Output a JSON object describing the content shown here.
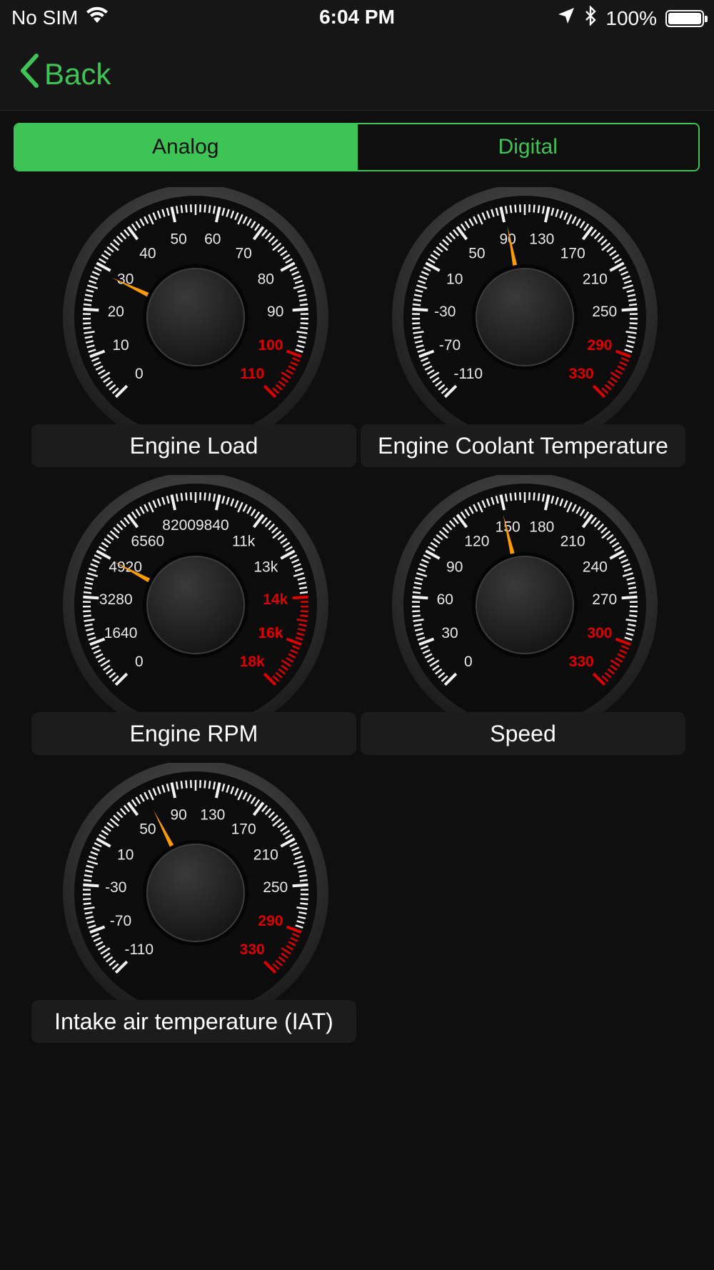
{
  "status_bar": {
    "carrier": "No SIM",
    "time": "6:04 PM",
    "battery": "100%"
  },
  "nav": {
    "back_label": "Back"
  },
  "segments": {
    "analog": "Analog",
    "digital": "Digital",
    "selected": "analog"
  },
  "colors": {
    "accent": "#3dc454",
    "redline": "#e00000",
    "needle": "#ff9a00"
  },
  "gauges": [
    {
      "id": "engine-load",
      "label": "Engine Load",
      "ticks": [
        "0",
        "10",
        "20",
        "30",
        "40",
        "50",
        "60",
        "70",
        "80",
        "90",
        "100",
        "110"
      ],
      "red_from": 10,
      "needle": 0.26
    },
    {
      "id": "coolant-temp",
      "label": "Engine Coolant Temperature",
      "ticks": [
        "-110",
        "-70",
        "-30",
        "10",
        "50",
        "90",
        "130",
        "170",
        "210",
        "250",
        "290",
        "330"
      ],
      "red_from": 10,
      "needle": 0.46
    },
    {
      "id": "engine-rpm",
      "label": "Engine RPM",
      "ticks": [
        "0",
        "1640",
        "3280",
        "4920",
        "6560",
        "82009840",
        "11k",
        "13k",
        "14k",
        "16k",
        "18k"
      ],
      "tick_slots": [
        0,
        1,
        2,
        3,
        4,
        5.5,
        7,
        8,
        9,
        10,
        11
      ],
      "red_from": 9,
      "needle": 0.27
    },
    {
      "id": "speed",
      "label": "Speed",
      "ticks": [
        "0",
        "30",
        "60",
        "90",
        "120",
        "150",
        "180",
        "210",
        "240",
        "270",
        "300",
        "330"
      ],
      "red_from": 10,
      "needle": 0.45
    },
    {
      "id": "iat",
      "label": "Intake air temperature (IAT)",
      "ticks": [
        "-110",
        "-70",
        "-30",
        "10",
        "50",
        "90",
        "130",
        "170",
        "210",
        "250",
        "290",
        "330"
      ],
      "red_from": 10,
      "needle": 0.4
    }
  ]
}
